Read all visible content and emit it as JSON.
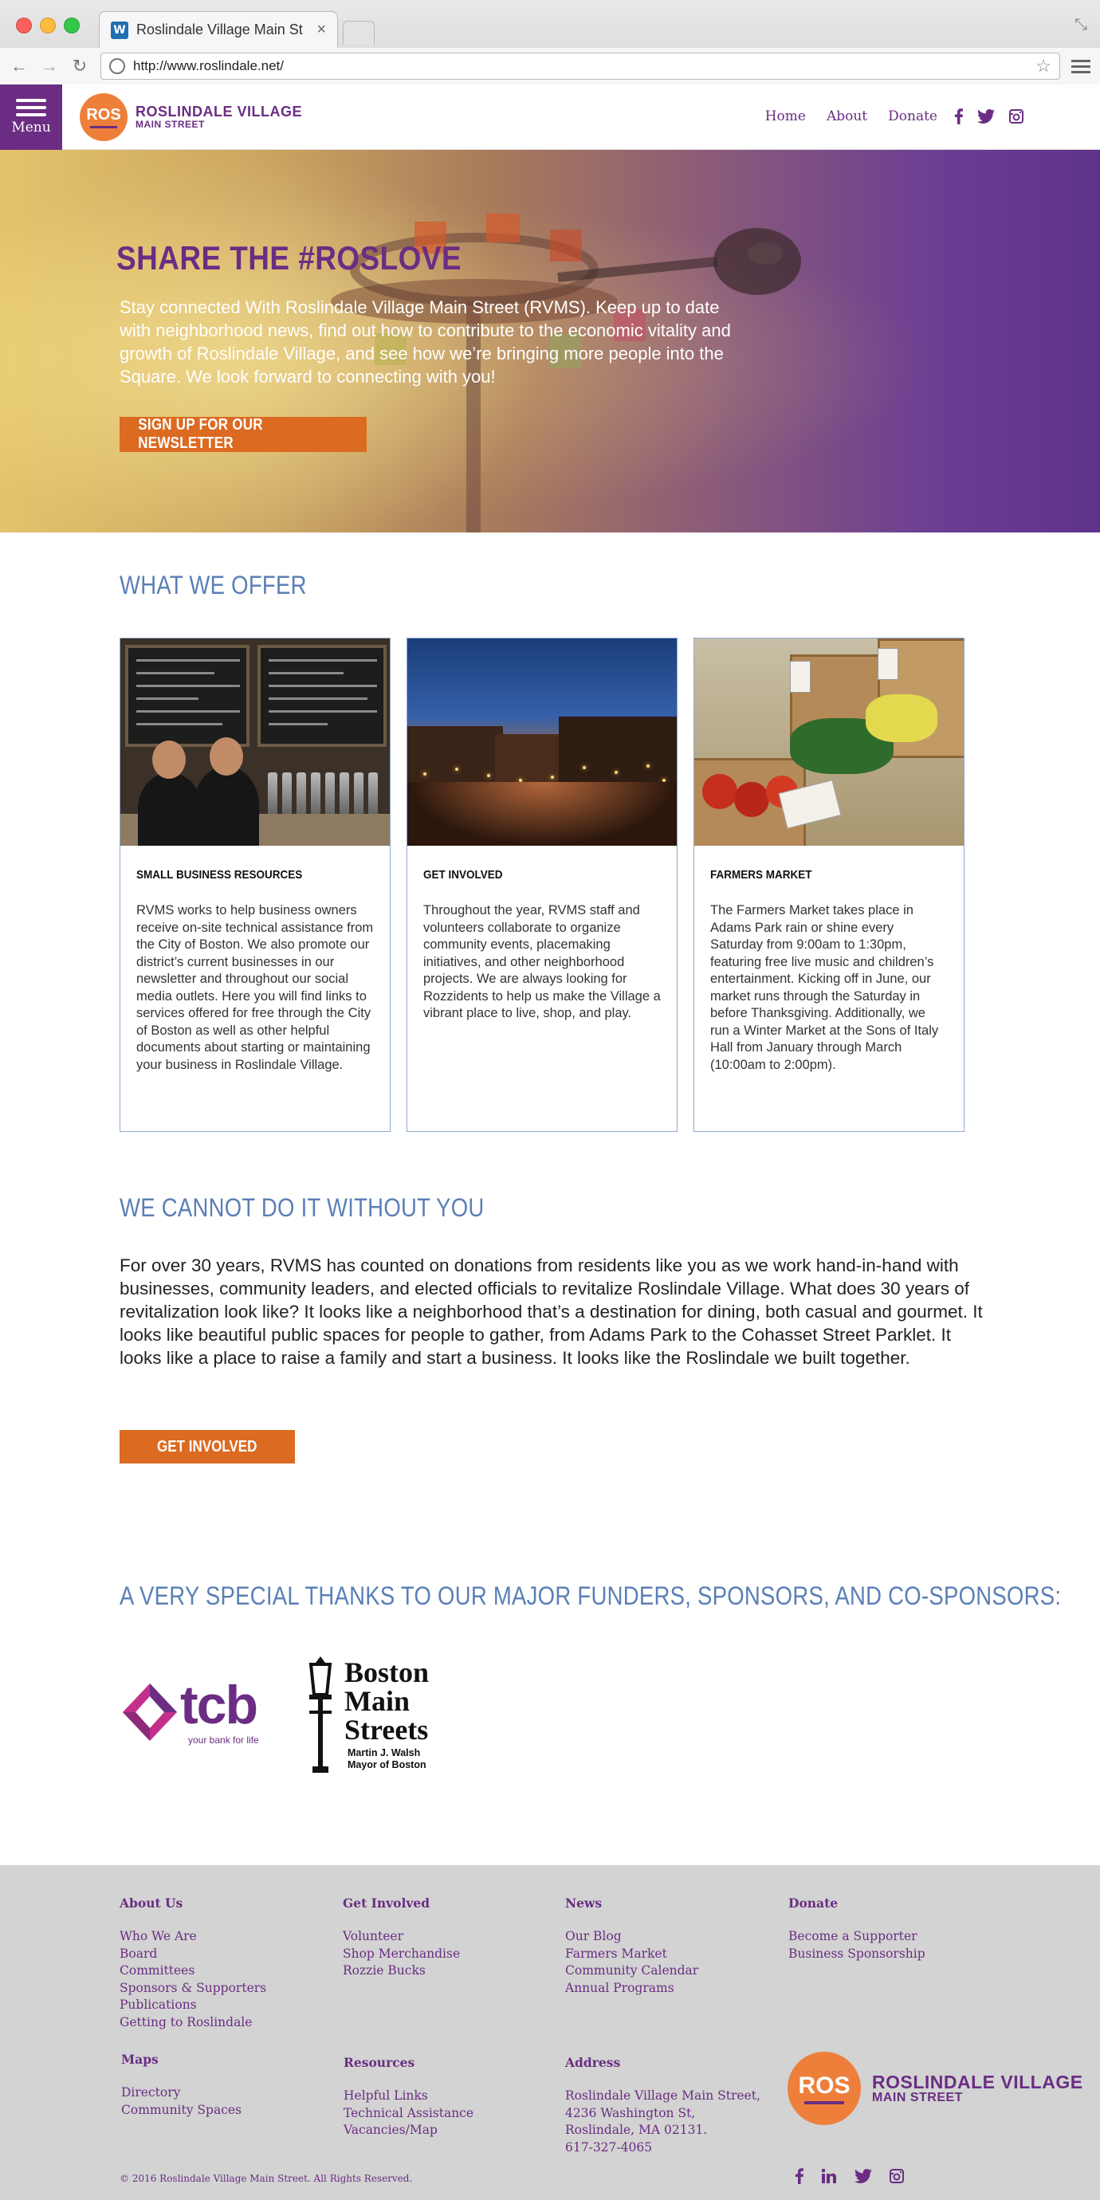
{
  "browser": {
    "tab_title": "Roslindale Village Main St",
    "tab_favicon": "W",
    "url": "http://www.roslindale.net/"
  },
  "header": {
    "menu_label": "Menu",
    "logo_mark": "ROS",
    "logo_line1": "ROSLINDALE VILLAGE",
    "logo_line2": "MAIN STREET",
    "nav": [
      "Home",
      "About",
      "Donate"
    ],
    "social_icons": [
      "facebook-icon",
      "twitter-icon",
      "instagram-icon"
    ]
  },
  "hero": {
    "title": "SHARE THE #ROSLOVE",
    "body": "Stay connected With Roslindale Village Main Street (RVMS). Keep up to date with neighborhood news, find out how to contribute to the economic vitality and growth of Roslindale Village, and see how we’re bringing more people into the Square. We look forward to connecting with you!",
    "button": "SIGN UP FOR OUR NEWSLETTER"
  },
  "offer": {
    "heading": "WHAT WE OFFER",
    "cards": [
      {
        "title": "SMALL BUSINESS RESOURCES",
        "text": "RVMS works to help business owners receive on-site technical assistance from the City of Boston. We also promote our district’s current businesses in our newsletter and throughout our social media outlets. Here you will find links to services offered for free through the City of Boston as well as other helpful documents about starting or maintaining your business in Roslindale Village."
      },
      {
        "title": "GET INVOLVED",
        "text": "Throughout the year, RVMS staff and volunteers collaborate to organize community events, placemaking initiatives, and other neighborhood projects. We are always looking for Rozzidents to  help us make the Village a vibrant place to live, shop, and play."
      },
      {
        "title": "FARMERS MARKET",
        "text": "The Farmers Market takes place in Adams Park rain or shine every Saturday from 9:00am to 1:30pm, featuring free live music and children’s entertainment. Kicking off in June, our market runs through the Saturday in before Thanksgiving. Additionally, we run a Winter Market at the Sons of Italy Hall from January through March (10:00am to 2:00pm)."
      }
    ]
  },
  "donate": {
    "heading": "WE CANNOT DO IT WITHOUT YOU",
    "text": "For over 30 years, RVMS has counted on donations from residents like you as we work hand-in-hand with businesses, community leaders, and elected officials to revitalize Roslindale Village. What does 30 years of revitalization look like? It looks like a neighborhood that’s a destination for dining, both casual and gourmet. It looks like beautiful public spaces for people to gather, from Adams Park to the Cohasset Street Parklet. It looks like a place to raise a family and start a business. It looks like the Roslindale we built together.",
    "button": "GET INVOLVED"
  },
  "sponsors": {
    "heading": "A VERY SPECIAL THANKS TO OUR MAJOR FUNDERS, SPONSORS, AND CO-SPONSORS:",
    "tcb_name": "tcb",
    "tcb_tagline": "your bank for life",
    "bms_line1": "Boston",
    "bms_line2": "Main",
    "bms_line3": "Streets",
    "bms_mayor1": "Martin J. Walsh",
    "bms_mayor2": "Mayor of Boston"
  },
  "footer": {
    "about": {
      "heading": "About Us",
      "links": [
        "Who We Are",
        "Board",
        "Committees",
        "Sponsors & Supporters",
        "Publications",
        "Getting to Roslindale"
      ]
    },
    "involved": {
      "heading": "Get Involved",
      "links": [
        "Volunteer",
        "Shop Merchandise",
        "Rozzie Bucks"
      ]
    },
    "news": {
      "heading": "News",
      "links": [
        "Our Blog",
        "Farmers Market",
        "Community Calendar",
        "Annual Programs"
      ]
    },
    "donate": {
      "heading": "Donate",
      "links": [
        "Become a Supporter",
        "Business Sponsorship"
      ]
    },
    "maps": {
      "heading": "Maps",
      "links": [
        "Directory",
        "Community Spaces"
      ]
    },
    "resources": {
      "heading": "Resources",
      "links": [
        "Helpful Links",
        "Technical Assistance",
        "Vacancies/Map"
      ]
    },
    "address": {
      "heading": "Address",
      "lines": [
        "Roslindale Village Main Street,",
        "4236 Washington St,",
        "Roslindale, MA 02131.",
        "617-327-4065"
      ]
    },
    "copyright": "© 2016 Roslindale Village Main Street. All Rights Reserved.",
    "social_icons": [
      "facebook-icon",
      "linkedin-icon",
      "twitter-icon",
      "instagram-icon"
    ]
  },
  "colors": {
    "brand_purple": "#6b2d83",
    "brand_orange": "#ee7f3a",
    "button_orange": "#dc6a21",
    "heading_blue": "#5a7fb6",
    "footer_gray": "#d2d3d2"
  }
}
